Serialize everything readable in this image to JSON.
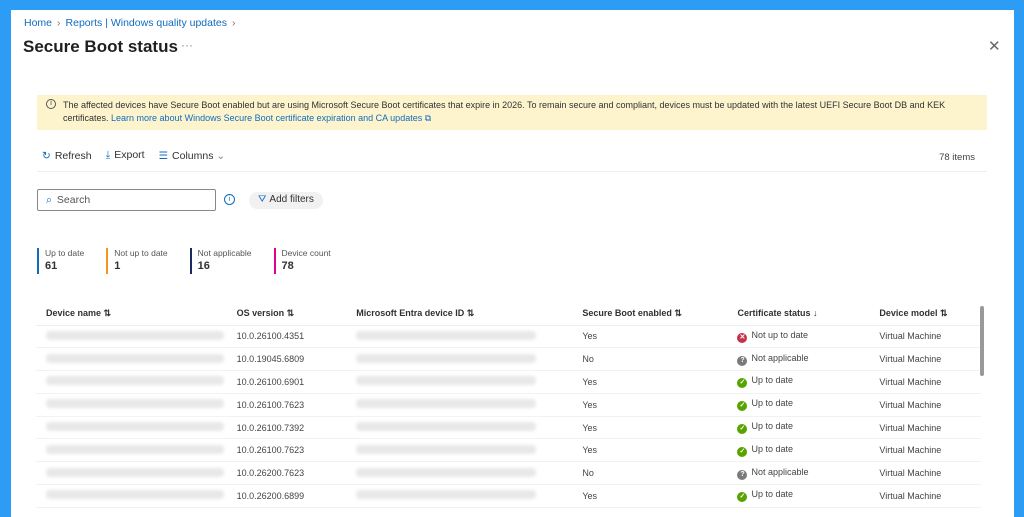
{
  "breadcrumb": [
    "Home",
    "Reports | Windows quality updates"
  ],
  "header": {
    "title": "Secure Boot status",
    "more": "···",
    "close": "✕"
  },
  "banner": {
    "text": "The affected devices have Secure Boot enabled but are using Microsoft Secure Boot certificates that expire in 2026. To remain secure and compliant, devices must be updated with the latest UEFI Secure Boot DB and KEK certificates.",
    "link": "Learn more about Windows Secure Boot certificate expiration and CA updates"
  },
  "toolbar": {
    "refresh": "Refresh",
    "export": "Export",
    "columns": "Columns",
    "items": "78 items"
  },
  "search": {
    "placeholder": "Search"
  },
  "filters": "Add filters",
  "stats": [
    {
      "label": "Up to date",
      "value": "61",
      "color": "#0f6cbd"
    },
    {
      "label": "Not up to date",
      "value": "1",
      "color": "#f7941d"
    },
    {
      "label": "Not applicable",
      "value": "16",
      "color": "#1b2a5a"
    },
    {
      "label": "Device count",
      "value": "78",
      "color": "#e3008c"
    }
  ],
  "table": {
    "columns": [
      "Device name ⇅",
      "OS version ⇅",
      "Microsoft Entra device ID ⇅",
      "Secure Boot enabled ⇅",
      "Certificate status ↓",
      "Device model ⇅"
    ],
    "rows": [
      [
        "10.0.26100.4351",
        "Yes",
        "Not up to date",
        "Virtual Machine"
      ],
      [
        "10.0.19045.6809",
        "No",
        "Not applicable",
        "Virtual Machine"
      ],
      [
        "10.0.26100.6901",
        "Yes",
        "Up to date",
        "Virtual Machine"
      ],
      [
        "10.0.26100.7623",
        "Yes",
        "Up to date",
        "Virtual Machine"
      ],
      [
        "10.0.26100.7392",
        "Yes",
        "Up to date",
        "Virtual Machine"
      ],
      [
        "10.0.26100.7623",
        "Yes",
        "Up to date",
        "Virtual Machine"
      ],
      [
        "10.0.26200.7623",
        "No",
        "Not applicable",
        "Virtual Machine"
      ],
      [
        "10.0.26200.6899",
        "Yes",
        "Up to date",
        "Virtual Machine"
      ]
    ]
  },
  "status_colors": {
    "Up to date": "#57a300",
    "Not up to date": "#c4314b",
    "Not applicable": "#7a7a7a"
  }
}
